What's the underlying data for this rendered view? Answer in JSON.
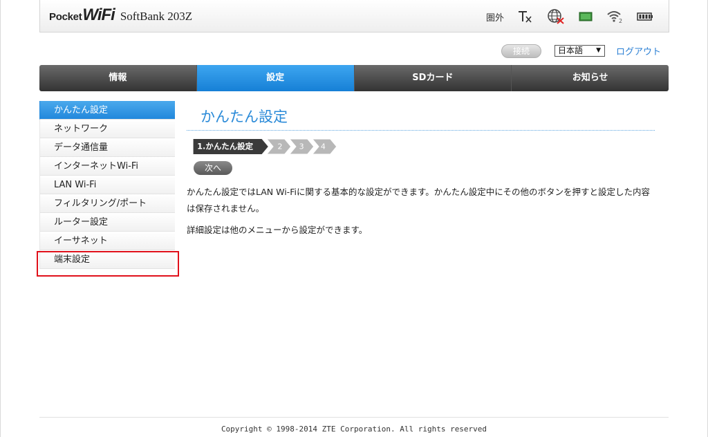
{
  "header": {
    "logo_pocket": "Pocket",
    "logo_wifi": "WiFi",
    "model": "SoftBank 203Z",
    "status": {
      "service_text": "圏外",
      "icons": [
        "no-sim-signal-icon",
        "internet-disconnected-icon",
        "sim-card-icon",
        "wifi-icon",
        "battery-icon"
      ],
      "wifi_clients": "2"
    }
  },
  "top_controls": {
    "connect_label": "接続",
    "language_value": "日本語",
    "logout_label": "ログアウト"
  },
  "main_nav": {
    "tabs": [
      {
        "label": "情報"
      },
      {
        "label": "設定"
      },
      {
        "label": "SDカード"
      },
      {
        "label": "お知らせ"
      }
    ],
    "active_index": 1
  },
  "sidebar": {
    "items": [
      {
        "label": "かんたん設定"
      },
      {
        "label": "ネットワーク"
      },
      {
        "label": "データ通信量"
      },
      {
        "label": "インターネットWi-Fi"
      },
      {
        "label": "LAN Wi-Fi"
      },
      {
        "label": "フィルタリング/ポート"
      },
      {
        "label": "ルーター設定"
      },
      {
        "label": "イーサネット"
      },
      {
        "label": "端末設定"
      }
    ],
    "active_index": 0
  },
  "content": {
    "title": "かんたん設定",
    "steps": [
      "1.かんたん設定",
      "2",
      "3",
      "4"
    ],
    "next_label": "次へ",
    "description": "かんたん設定ではLAN Wi-Fiに関する基本的な設定ができます。かんたん設定中にその他のボタンを押すと設定した内容は保存されません。",
    "description2": "詳細設定は他のメニューから設定ができます。"
  },
  "footer": {
    "copyright": "Copyright © 1998-2014 ZTE Corporation. All rights reserved"
  },
  "colors": {
    "accent_blue": "#2288dc",
    "highlight_red": "#e0101a",
    "nav_dark": "#333333"
  }
}
